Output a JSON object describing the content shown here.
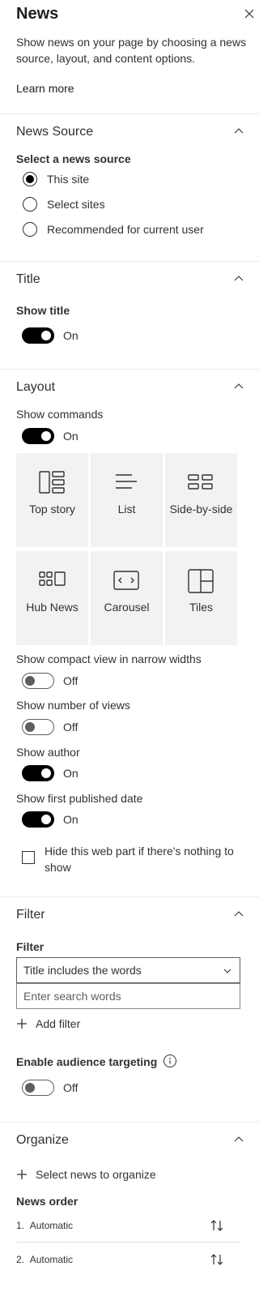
{
  "panel": {
    "title": "News",
    "description": "Show news on your page by choosing a news source, layout, and content options.",
    "learn_more": "Learn more"
  },
  "news_source": {
    "section_title": "News Source",
    "select_label": "Select a news source",
    "options": [
      {
        "label": "This site",
        "checked": true
      },
      {
        "label": "Select sites",
        "checked": false
      },
      {
        "label": "Recommended for current user",
        "checked": false
      }
    ]
  },
  "title_section": {
    "section_title": "Title",
    "show_title_label": "Show title",
    "show_title_state": "On"
  },
  "layout": {
    "section_title": "Layout",
    "show_commands_label": "Show commands",
    "show_commands_state": "On",
    "tiles": [
      {
        "label": "Top story",
        "icon": "top-story-icon"
      },
      {
        "label": "List",
        "icon": "list-icon"
      },
      {
        "label": "Side-by-side",
        "icon": "side-by-side-icon"
      },
      {
        "label": "Hub News",
        "icon": "hub-news-icon"
      },
      {
        "label": "Carousel",
        "icon": "carousel-icon"
      },
      {
        "label": "Tiles",
        "icon": "tiles-icon"
      }
    ],
    "compact_label": "Show compact view in narrow widths",
    "compact_state": "Off",
    "views_label": "Show number of views",
    "views_state": "Off",
    "author_label": "Show author",
    "author_state": "On",
    "published_label": "Show first published date",
    "published_state": "On",
    "hide_label": "Hide this web part if there's nothing to show",
    "hide_checked": false
  },
  "filter": {
    "section_title": "Filter",
    "filter_label": "Filter",
    "selected": "Title includes the words",
    "search_placeholder": "Enter search words",
    "add_filter": "Add filter",
    "audience_label": "Enable audience targeting",
    "audience_state": "Off"
  },
  "organize": {
    "section_title": "Organize",
    "select_news": "Select news to organize",
    "order_label": "News order",
    "order": [
      {
        "index": "1.",
        "value": "Automatic"
      },
      {
        "index": "2.",
        "value": "Automatic"
      }
    ]
  },
  "colors": {
    "text": "#323130",
    "toggle_on": "#000000",
    "tile_bg": "#f3f2f1",
    "divider": "#edebe9"
  }
}
